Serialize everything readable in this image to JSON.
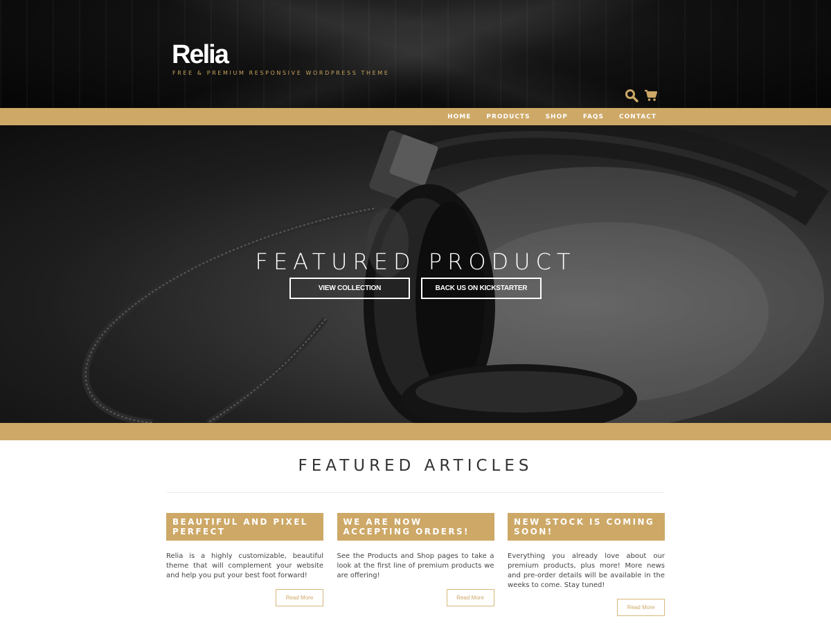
{
  "site": {
    "logo": "Relia",
    "tagline": "FREE & PREMIUM RESPONSIVE WORDPRESS THEME"
  },
  "header_icons": {
    "search": "search-icon",
    "cart": "cart-icon"
  },
  "nav": {
    "items": [
      {
        "label": "HOME"
      },
      {
        "label": "PRODUCTS"
      },
      {
        "label": "SHOP"
      },
      {
        "label": "FAQS"
      },
      {
        "label": "CONTACT"
      }
    ]
  },
  "hero": {
    "title": "FEATURED PRODUCT",
    "buttons": [
      {
        "label": "VIEW COLLECTION"
      },
      {
        "label": "BACK US ON KICKSTARTER"
      }
    ]
  },
  "featured": {
    "title": "FEATURED ARTICLES",
    "articles": [
      {
        "title": "BEAUTIFUL AND PIXEL PERFECT",
        "text": "Relia is a highly customizable, beautiful theme that will complement your website and help you put your best foot forward!",
        "button": "Read More"
      },
      {
        "title": "WE ARE NOW ACCEPTING ORDERS!",
        "text": "See the Products and Shop pages to take a look at the first line of premium products we are offering!",
        "button": "Read More"
      },
      {
        "title": "NEW STOCK IS COMING SOON!",
        "text": "Everything you already love about our premium products, plus more! More news and pre-order details will be available in the weeks to come. Stay tuned!",
        "button": "Read More"
      }
    ]
  },
  "colors": {
    "accent": "#cda867",
    "header_bg": "#0a0a0a"
  }
}
